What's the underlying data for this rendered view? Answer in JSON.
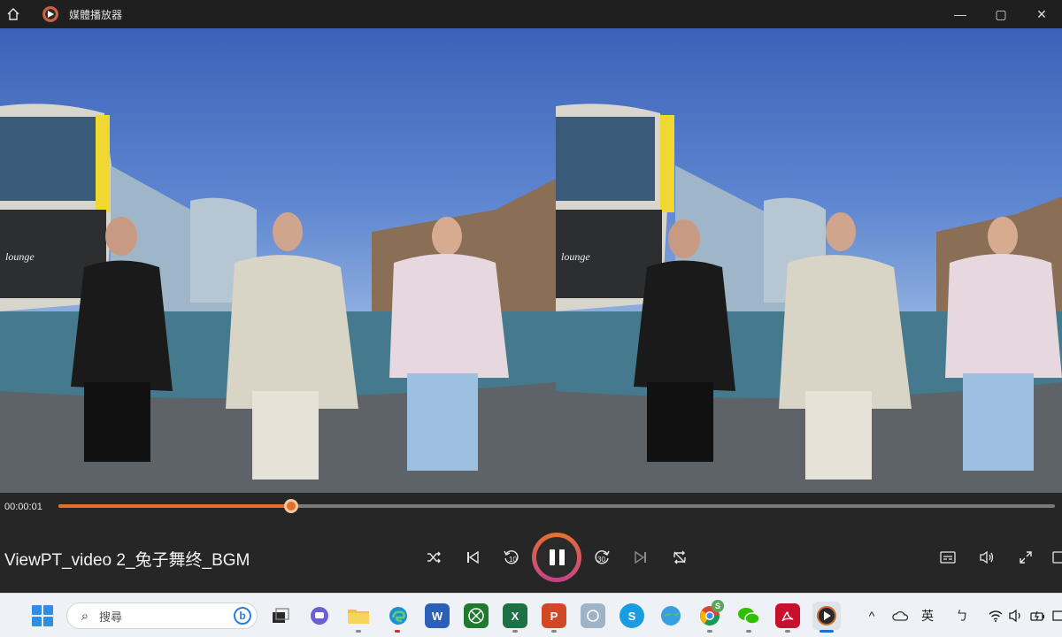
{
  "window": {
    "title": "媒體播放器",
    "controls": {
      "minimize": "—",
      "maximize": "▢",
      "close": "✕"
    }
  },
  "video": {
    "overlay_text_left": "lounge",
    "overlay_text_right": "lounge"
  },
  "player": {
    "elapsed": "00:00:01",
    "progress_fraction": 0.234,
    "media_title": "ViewPT_video 2_兔子舞终_BGM",
    "controls": {
      "shuffle": "shuffle-icon",
      "previous": "previous-icon",
      "rewind": "10",
      "play_pause": "pause-icon",
      "forward": "30",
      "next": "next-icon",
      "repeat": "repeat-icon",
      "subtitles": "subtitles-icon",
      "volume": "volume-icon",
      "fullscreen": "fullscreen-icon"
    }
  },
  "taskbar": {
    "search_placeholder": "搜尋",
    "bing_label": "b",
    "chrome_badge": "S",
    "apps": [
      "file-explorer",
      "edge",
      "word",
      "xbox",
      "excel",
      "powerpoint",
      "app",
      "skype",
      "weather",
      "chrome",
      "wechat",
      "acrobat",
      "media-player"
    ],
    "apps_labels": {
      "word": "W",
      "excel": "X",
      "powerpoint": "P",
      "skype": "S"
    },
    "tray": {
      "chevron": "^",
      "ime_lang": "英",
      "ime_mode": "ㄅ"
    }
  },
  "colors": {
    "accent": "#e0702a",
    "accent2": "#c23f8f",
    "taskbar_bg": "#eef1f6",
    "player_bg": "#262626"
  }
}
